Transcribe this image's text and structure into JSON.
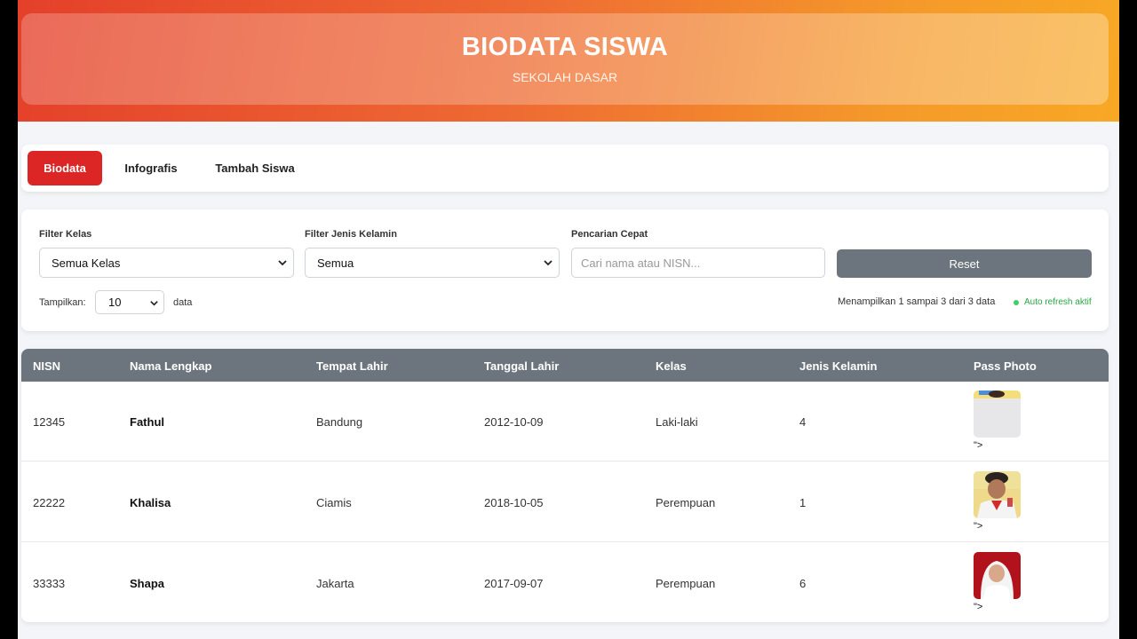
{
  "header": {
    "title": "BIODATA SISWA",
    "subtitle": "SEKOLAH DASAR"
  },
  "tabs": [
    {
      "label": "Biodata",
      "active": true
    },
    {
      "label": "Infografis",
      "active": false
    },
    {
      "label": "Tambah Siswa",
      "active": false
    }
  ],
  "filters": {
    "kelas_label": "Filter Kelas",
    "kelas_value": "Semua Kelas",
    "gender_label": "Filter Jenis Kelamin",
    "gender_value": "Semua",
    "search_label": "Pencarian Cepat",
    "search_placeholder": "Cari nama atau NISN...",
    "reset_label": "Reset",
    "show_label": "Tampilkan:",
    "show_value": "10",
    "data_label": "data",
    "info_text": "Menampilkan 1 sampai 3 dari 3 data",
    "auto_refresh": "Auto refresh aktif"
  },
  "table": {
    "headers": [
      "NISN",
      "Nama Lengkap",
      "Tempat Lahir",
      "Tanggal Lahir",
      "Kelas",
      "Jenis Kelamin",
      "Pass Photo"
    ],
    "rows": [
      {
        "nisn": "12345",
        "nama": "Fathul",
        "tempat": "Bandung",
        "tanggal": "2012-10-09",
        "kelas": "Laki-laki",
        "jenis": "4",
        "photo_suffix": "\">"
      },
      {
        "nisn": "22222",
        "nama": "Khalisa",
        "tempat": "Ciamis",
        "tanggal": "2018-10-05",
        "kelas": "Perempuan",
        "jenis": "1",
        "photo_suffix": "\">"
      },
      {
        "nisn": "33333",
        "nama": "Shapa",
        "tempat": "Jakarta",
        "tanggal": "2017-09-07",
        "kelas": "Perempuan",
        "jenis": "6",
        "photo_suffix": "\">"
      }
    ]
  },
  "colors": {
    "accent_red": "#dc2626",
    "table_header": "#6c757d",
    "status_green": "#28a745"
  }
}
